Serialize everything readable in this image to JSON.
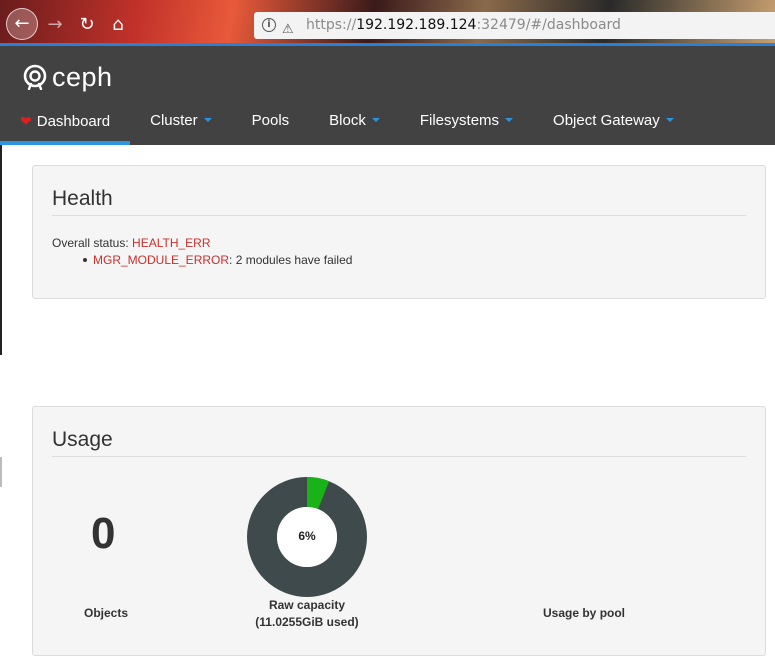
{
  "browser": {
    "url_scheme": "https://",
    "url_host": "192.192.189.124",
    "url_rest": ":32479/#/dashboard"
  },
  "app": {
    "logo_text": "ceph",
    "menu": [
      {
        "label": "Dashboard",
        "active": true
      },
      {
        "label": "Cluster",
        "dropdown": true
      },
      {
        "label": "Pools"
      },
      {
        "label": "Block",
        "dropdown": true
      },
      {
        "label": "Filesystems",
        "dropdown": true
      },
      {
        "label": "Object Gateway",
        "dropdown": true
      }
    ]
  },
  "health": {
    "title": "Health",
    "overall_label": "Overall status:",
    "overall_value": "HEALTH_ERR",
    "checks": [
      {
        "code": "MGR_MODULE_ERROR",
        "message": ": 2 modules have failed"
      }
    ]
  },
  "usage": {
    "title": "Usage",
    "objects_count": "0",
    "objects_label": "Objects",
    "raw_capacity_pct_label": "6%",
    "raw_capacity_fraction": 0.06,
    "raw_capacity_label": "Raw capacity",
    "raw_capacity_used": "(11.0255GiB used)",
    "pool_label": "Usage by pool"
  },
  "colors": {
    "accent": "#2b95e0",
    "error": "#c9302c",
    "donut_used": "#19b219",
    "donut_free": "#3f4a4c"
  }
}
